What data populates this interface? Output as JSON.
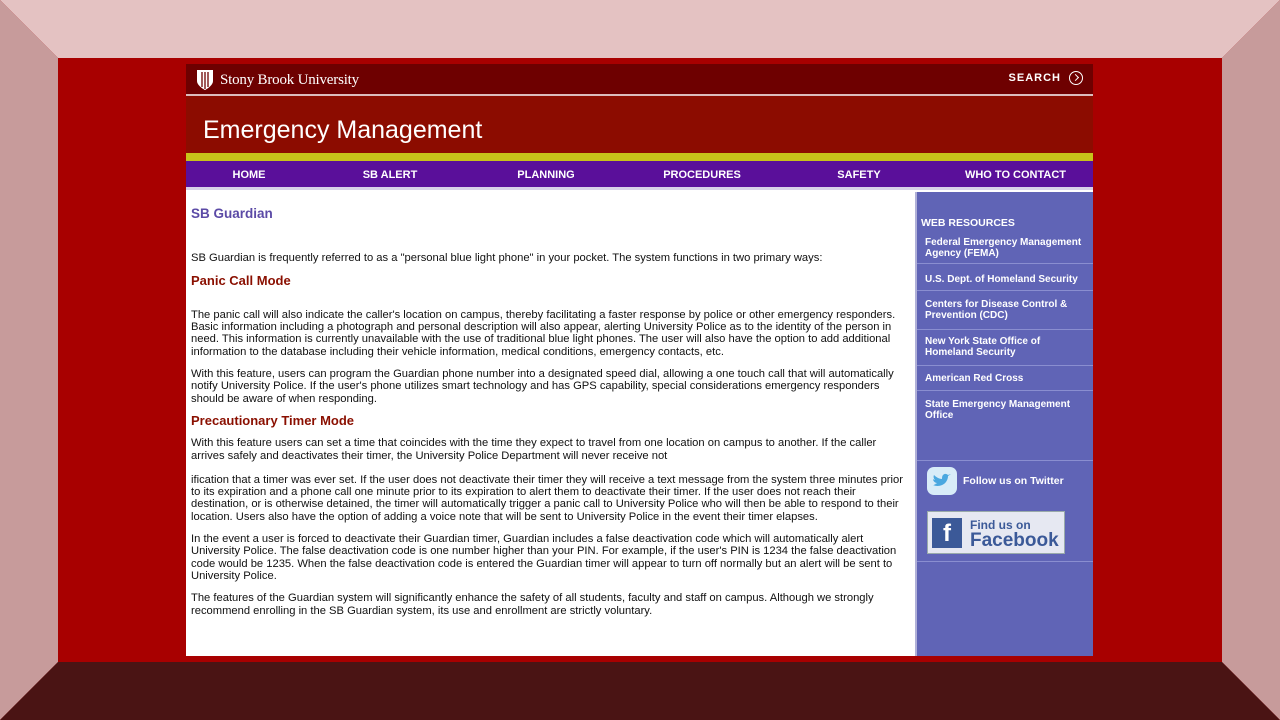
{
  "header": {
    "university": "Stony Brook University",
    "search_label": "SEARCH",
    "site_title": "Emergency Management"
  },
  "nav": [
    "HOME",
    "SB ALERT",
    "PLANNING",
    "PROCEDURES",
    "SAFETY",
    "WHO TO CONTACT"
  ],
  "main": {
    "title": "SB Guardian",
    "intro": "SB Guardian is frequently referred to as a \"personal blue light phone\" in your pocket.  The system functions in two primary ways:",
    "section1_title": "Panic Call Mode",
    "p1": "The panic call will also indicate the caller's location on campus, thereby facilitating a faster response by police or other emergency responders. Basic information including a photograph and personal description will also appear, alerting University Police as to the identity of the person in need. This information is currently unavailable with the use of traditional blue light phones. The user will also have the option to add additional information to the database including their vehicle information, medical conditions, emergency contacts, etc.",
    "p2": "With this feature, users can program the Guardian phone number into a designated speed dial, allowing a one touch call that will automatically notify University Police. If the user's phone utilizes smart technology and has GPS capability, special considerations emergency responders should be aware of when responding.",
    "section2_title": "Precautionary Timer Mode",
    "p3": "With this feature users can set a time that coincides with the time they expect to travel from one location on campus to another. If the caller arrives safely and deactivates their timer, the University Police Department will never receive not",
    "p4": "ification that a timer was ever set. If the user does not deactivate their timer they will receive a text message from the system three minutes prior to its expiration and a phone call one minute prior to its expiration to alert them to deactivate their timer. If the user does not reach their destination, or is otherwise detained, the timer will automatically trigger a panic call to University Police who will then be able to respond to their location. Users also have the option of adding a voice note that will be sent to University Police in the event their timer elapses.",
    "p5": "In the event a user is forced to deactivate their Guardian timer, Guardian includes a false deactivation code which will automatically alert University Police. The false deactivation code is one number higher than your PIN. For example, if the user's PIN is 1234 the false deactivation code would be 1235. When the false deactivation code is entered the Guardian timer will appear to turn off normally but an alert will be sent to University Police.",
    "p6": "The features of the Guardian system will significantly enhance the safety of all students, faculty and staff on campus. Although we strongly recommend enrolling in the SB Guardian system, its use and enrollment are strictly voluntary."
  },
  "sidebar": {
    "heading": "WEB RESOURCES",
    "links": [
      "Federal Emergency Management Agency (FEMA)",
      "U.S. Dept. of Homeland Security",
      "Centers for Disease Control & Prevention (CDC)",
      "New York State Office of Homeland Security",
      "American Red Cross",
      "State Emergency Management Office"
    ],
    "twitter_label": "Follow us on Twitter",
    "facebook_line1": "Find us on",
    "facebook_line2": "Facebook"
  },
  "colors": {
    "background": "#a80000",
    "banner": "#8c0c00",
    "nav": "#5a0f9a",
    "sidebar": "#6064b6",
    "accent_gold": "#c7c21a"
  }
}
